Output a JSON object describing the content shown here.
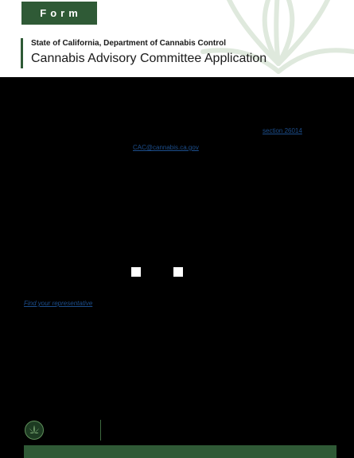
{
  "header": {
    "form_label": "Form",
    "agency": "State of California, Department of Cannabis Control",
    "title": "Cannabis Advisory Committee Application"
  },
  "links": {
    "section": "section 26014",
    "email": "CAC@cannabis.ca.gov",
    "representative": "Find your representative"
  },
  "colors": {
    "brand_green": "#2f5a36",
    "link_blue": "#1c4e8c"
  },
  "icons": {
    "watermark": "cannabis-leaf-icon",
    "footer_logo": "cannabis-seal-icon"
  }
}
